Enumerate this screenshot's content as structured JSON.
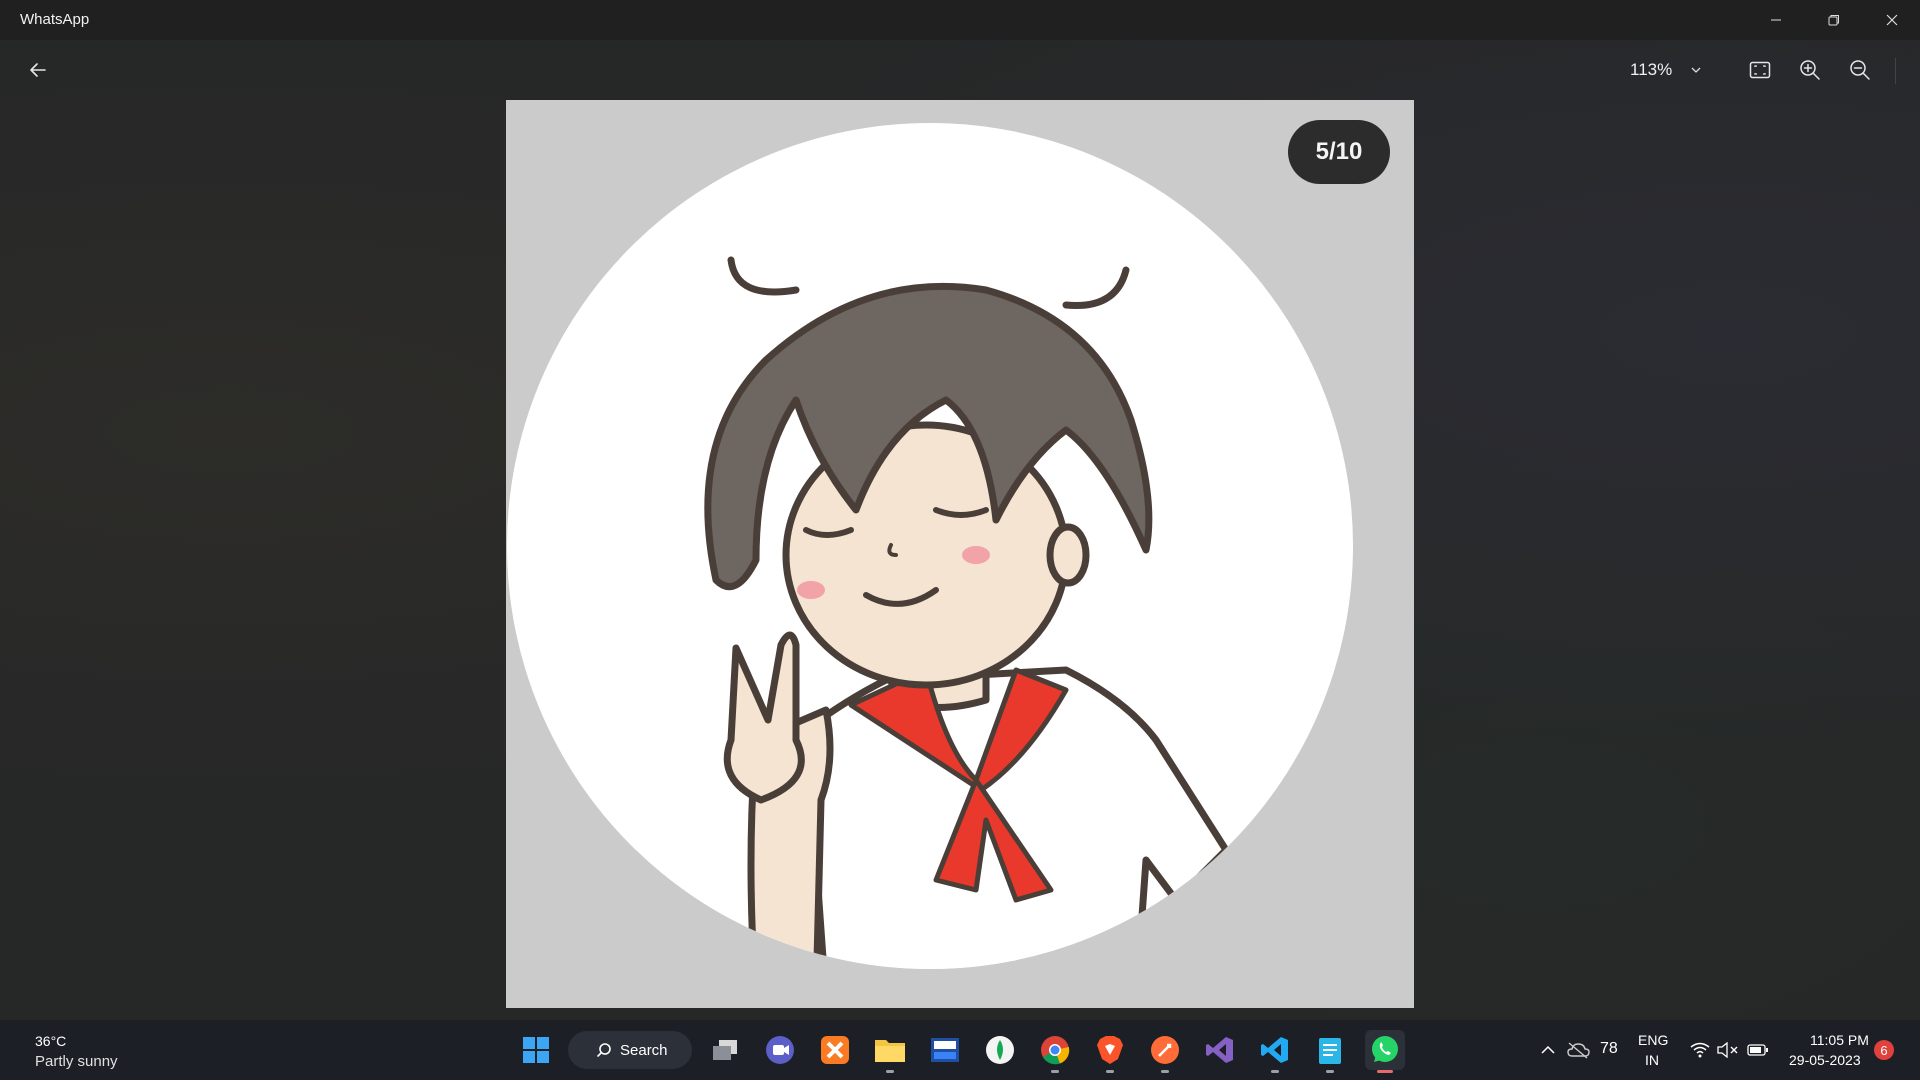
{
  "window": {
    "title": "WhatsApp",
    "controls": [
      "minimize-icon",
      "restore-icon",
      "close-icon"
    ]
  },
  "toolbar": {
    "back_icon": "arrow-left-icon",
    "zoom_level": "113%",
    "zoom_dropdown_icon": "chevron-down-icon",
    "buttons": [
      "fit-screen-icon",
      "zoom-in-icon",
      "zoom-out-icon"
    ]
  },
  "image": {
    "counter": "5/10",
    "subject": "cartoon boy avatar making peace sign"
  },
  "taskbar": {
    "weather": {
      "temperature": "36°C",
      "condition": "Partly sunny"
    },
    "search_label": "Search",
    "apps": [
      "windows-start-icon",
      "task-view-icon",
      "meet-icon",
      "xampp-icon",
      "file-explorer-icon",
      "devc-icon",
      "mongodb-compass-icon",
      "chrome-icon",
      "brave-icon",
      "postman-icon",
      "visual-studio-icon",
      "vscode-icon",
      "notepad-icon",
      "whatsapp-icon"
    ],
    "tray": {
      "network_count": "78",
      "language_line1": "ENG",
      "language_line2": "IN",
      "time": "11:05 PM",
      "date": "29-05-2023",
      "notifications": "6"
    }
  },
  "colors": {
    "titlebar": "#202020",
    "viewer_background": "#262727",
    "taskbar": "#1c1f25",
    "scarf_red": "#e8392c",
    "whatsapp_green": "#25d366"
  }
}
